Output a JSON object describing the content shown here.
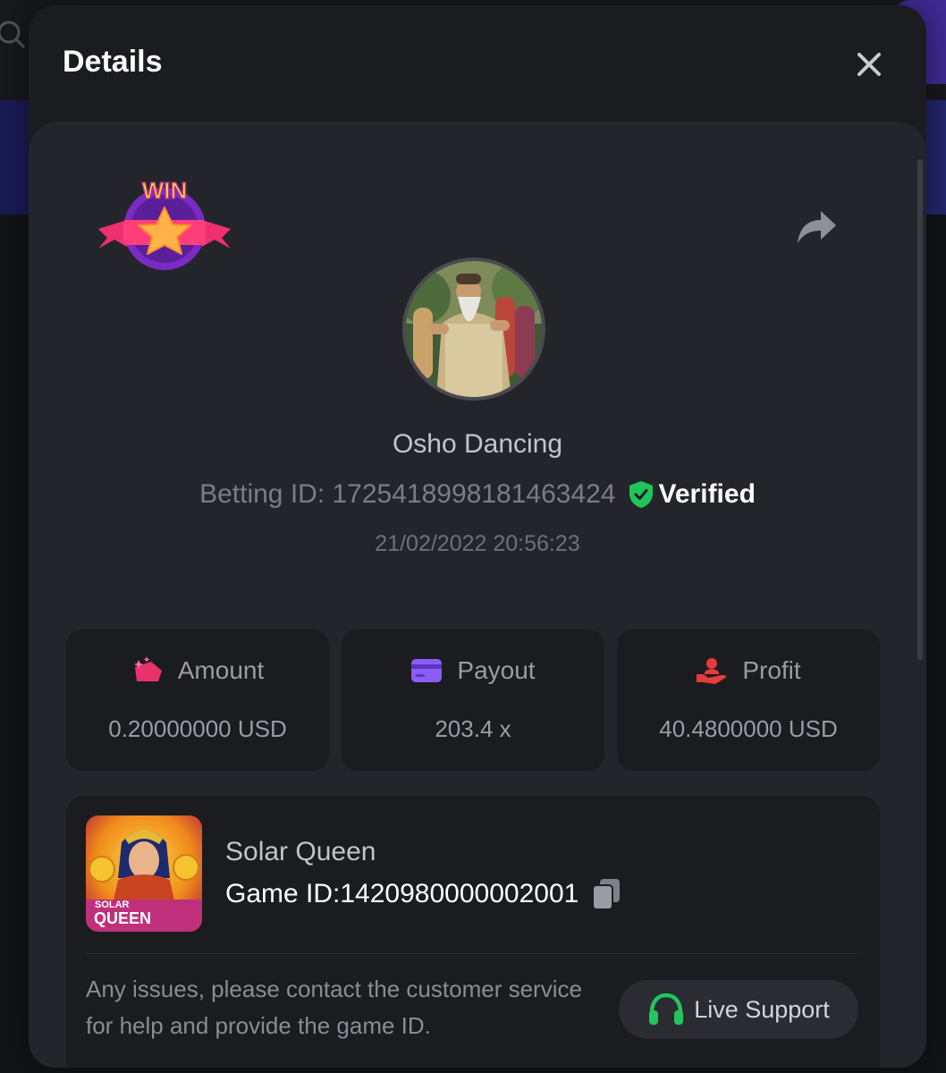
{
  "modal": {
    "title": "Details"
  },
  "player": {
    "name": "Osho Dancing",
    "betting_id": "Betting ID: 1725418998181463424",
    "verified_label": "Verified",
    "timestamp": "21/02/2022 20:56:23"
  },
  "badge": {
    "text": "WIN"
  },
  "stats": {
    "amount": {
      "label": "Amount",
      "value": "0.20000000 USD"
    },
    "payout": {
      "label": "Payout",
      "value": "203.4 x"
    },
    "profit": {
      "label": "Profit",
      "value": "40.4800000 USD"
    }
  },
  "game": {
    "name": "Solar Queen",
    "id": "Game ID:1420980000002001",
    "thumb_line1": "SOLAR",
    "thumb_line2": "QUEEN"
  },
  "support": {
    "notice": "Any issues, please contact the customer service for help and provide the game ID.",
    "button_label": "Live Support"
  },
  "colors": {
    "verified_green": "#1fc55a",
    "support_green": "#22c55e",
    "amount_pink": "#e8326b",
    "payout_purple": "#8b5cf6",
    "profit_red": "#e53b3b"
  }
}
